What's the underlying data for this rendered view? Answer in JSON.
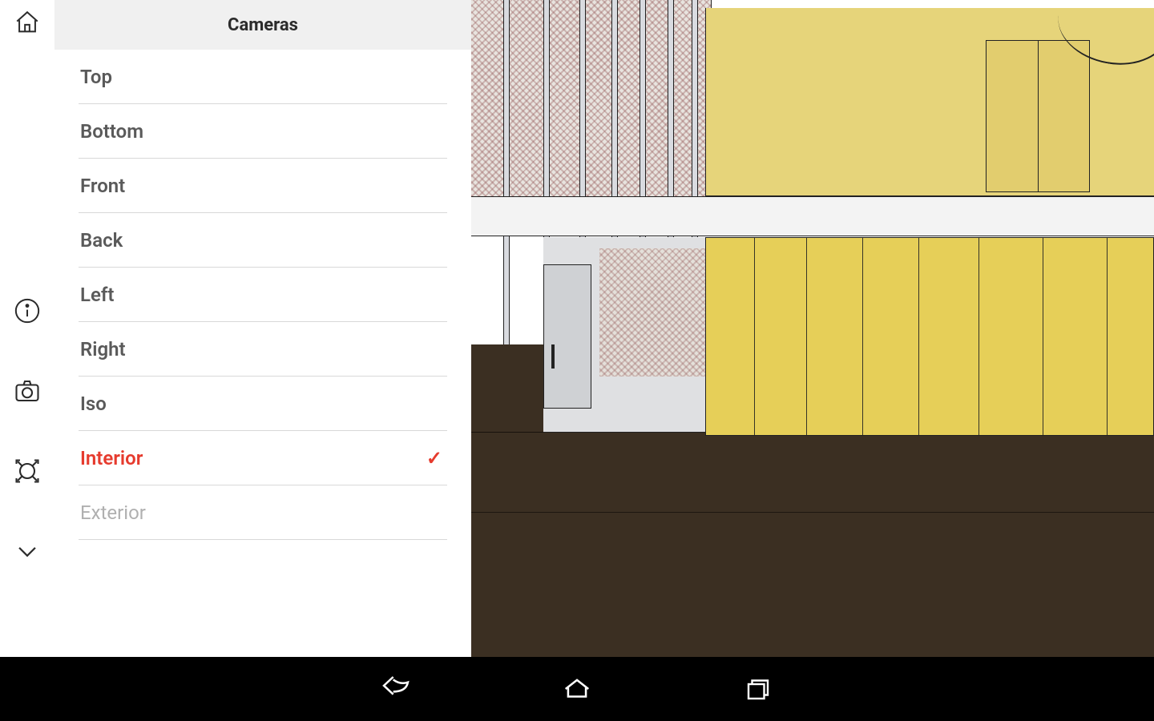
{
  "panel": {
    "title": "Cameras"
  },
  "cameras": [
    {
      "label": "Top",
      "selected": false,
      "disabled": false
    },
    {
      "label": "Bottom",
      "selected": false,
      "disabled": false
    },
    {
      "label": "Front",
      "selected": false,
      "disabled": false
    },
    {
      "label": "Back",
      "selected": false,
      "disabled": false
    },
    {
      "label": "Left",
      "selected": false,
      "disabled": false
    },
    {
      "label": "Right",
      "selected": false,
      "disabled": false
    },
    {
      "label": "Iso",
      "selected": false,
      "disabled": false
    },
    {
      "label": "Interior",
      "selected": true,
      "disabled": false
    },
    {
      "label": "Exterior",
      "selected": false,
      "disabled": true
    }
  ],
  "colors": {
    "accent": "#e63b2e",
    "wall_yellow": "#e6cf58",
    "floor": "#3b2f22"
  }
}
